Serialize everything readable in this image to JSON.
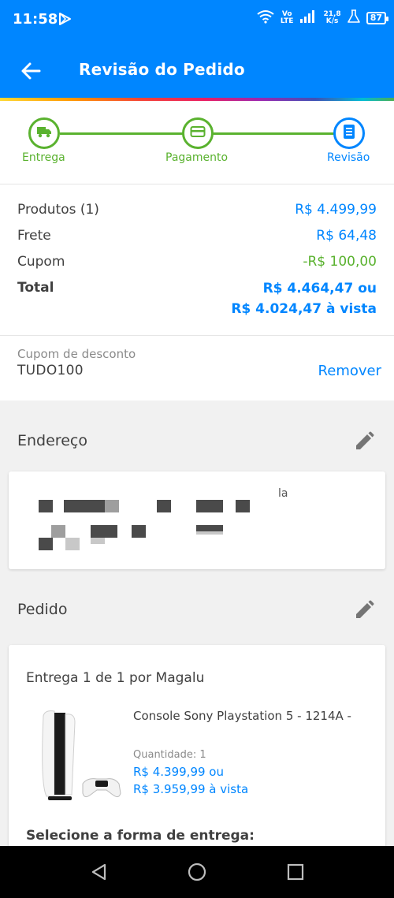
{
  "status_bar": {
    "time": "11:58",
    "network_top": "Vo",
    "network_bottom": "LTE",
    "speed_top": "21,8",
    "speed_bottom": "K/s",
    "battery": "87"
  },
  "app_bar": {
    "title": "Revisão do Pedido",
    "back_icon": "arrow-back-icon"
  },
  "stepper": {
    "steps": [
      {
        "label": "Entrega",
        "icon": "truck-icon",
        "state": "done"
      },
      {
        "label": "Pagamento",
        "icon": "credit-card-icon",
        "state": "done"
      },
      {
        "label": "Revisão",
        "icon": "receipt-icon",
        "state": "current"
      }
    ]
  },
  "summary": {
    "products_label": "Produtos (1)",
    "products_value": "R$ 4.499,99",
    "shipping_label": "Frete",
    "shipping_value": "R$ 64,48",
    "coupon_label": "Cupom",
    "coupon_value": "-R$ 100,00",
    "total_label": "Total",
    "total_value_installments": "R$ 4.464,47 ou",
    "total_value_cash": "R$ 4.024,47 à vista"
  },
  "coupon": {
    "label": "Cupom de desconto",
    "code": "TUDO100",
    "remove_label": "Remover"
  },
  "address": {
    "title": "Endereço",
    "partial_text": "la"
  },
  "order": {
    "title": "Pedido",
    "delivery_header": "Entrega 1 de 1 por Magalu",
    "product_name": "Console Sony Playstation 5 - 1214A -",
    "quantity": "Quantidade:  1",
    "price_installments": "R$ 4.399,99 ou",
    "price_cash": "R$ 3.959,99 à vista",
    "select_delivery": "Selecione a forma de entrega:"
  },
  "colors": {
    "brand_blue": "#0086ff",
    "success_green": "#5ab22f",
    "text_dark": "#404040",
    "background_gray": "#f1f1f1"
  }
}
